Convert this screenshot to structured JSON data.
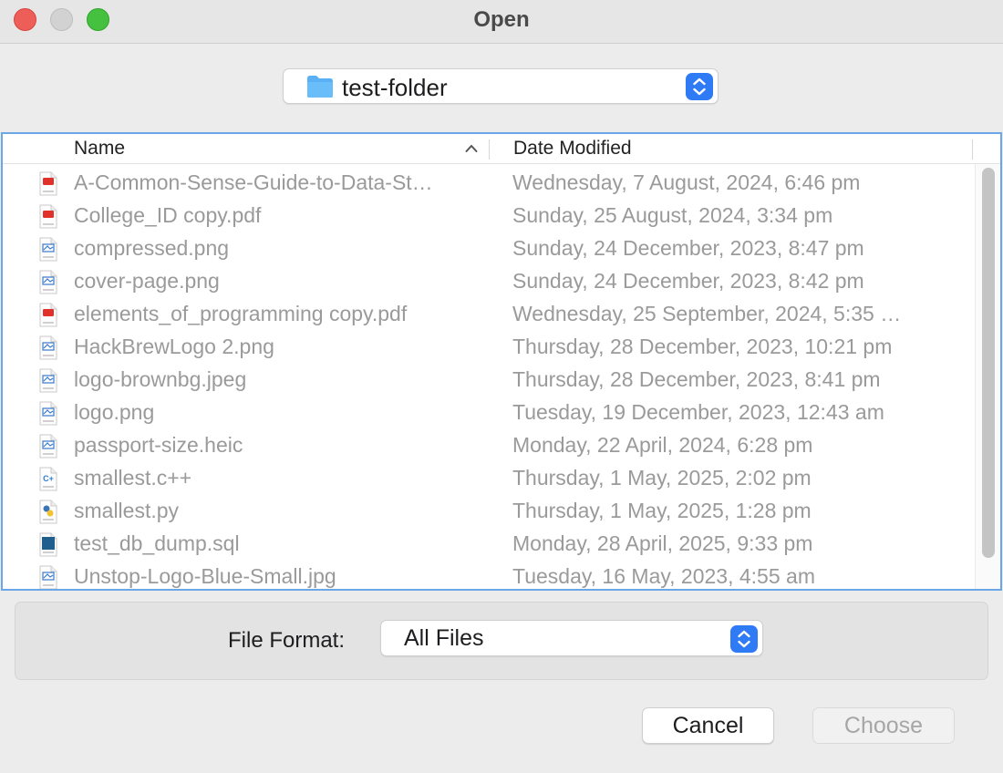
{
  "window": {
    "title": "Open"
  },
  "location": {
    "folder": "test-folder"
  },
  "columns": {
    "name": "Name",
    "date_modified": "Date Modified"
  },
  "files": [
    {
      "name": "A-Common-Sense-Guide-to-Data-St…",
      "date": "Wednesday, 7 August, 2024, 6:46 pm",
      "icon": "pdf-file-icon",
      "type": "pdf"
    },
    {
      "name": "College_ID copy.pdf",
      "date": "Sunday, 25 August, 2024, 3:34 pm",
      "icon": "pdf-file-icon",
      "type": "pdf"
    },
    {
      "name": "compressed.png",
      "date": "Sunday, 24 December, 2023, 8:47 pm",
      "icon": "png-file-icon",
      "type": "png"
    },
    {
      "name": "cover-page.png",
      "date": "Sunday, 24 December, 2023, 8:42 pm",
      "icon": "png-file-icon",
      "type": "png"
    },
    {
      "name": "elements_of_programming copy.pdf",
      "date": "Wednesday, 25 September, 2024, 5:35 …",
      "icon": "pdf-file-icon",
      "type": "pdf"
    },
    {
      "name": "HackBrewLogo 2.png",
      "date": "Thursday, 28 December, 2023, 10:21 pm",
      "icon": "png-file-icon",
      "type": "png"
    },
    {
      "name": "logo-brownbg.jpeg",
      "date": "Thursday, 28 December, 2023, 8:41 pm",
      "icon": "jpeg-file-icon",
      "type": "jpeg"
    },
    {
      "name": "logo.png",
      "date": "Tuesday, 19 December, 2023, 12:43 am",
      "icon": "png-file-icon",
      "type": "png"
    },
    {
      "name": "passport-size.heic",
      "date": "Monday, 22 April, 2024, 6:28 pm",
      "icon": "heic-file-icon",
      "type": "heic"
    },
    {
      "name": "smallest.c++",
      "date": "Thursday, 1 May, 2025, 2:02 pm",
      "icon": "cpp-file-icon",
      "type": "cpp"
    },
    {
      "name": "smallest.py",
      "date": "Thursday, 1 May, 2025, 1:28 pm",
      "icon": "python-file-icon",
      "type": "py"
    },
    {
      "name": "test_db_dump.sql",
      "date": "Monday, 28 April, 2025, 9:33 pm",
      "icon": "sql-file-icon",
      "type": "sql"
    },
    {
      "name": "Unstop-Logo-Blue-Small.jpg",
      "date": "Tuesday, 16 May, 2023, 4:55 am",
      "icon": "jpeg-file-icon",
      "type": "jpeg"
    }
  ],
  "file_format": {
    "label": "File Format:",
    "value": "All Files"
  },
  "buttons": {
    "cancel": "Cancel",
    "choose": "Choose"
  },
  "colors": {
    "accent": "#2f7bf5",
    "list_border": "#6aa6e8",
    "dimmed_text": "#9a9a9a",
    "close": "#ee5e58",
    "zoom": "#45c13f"
  }
}
